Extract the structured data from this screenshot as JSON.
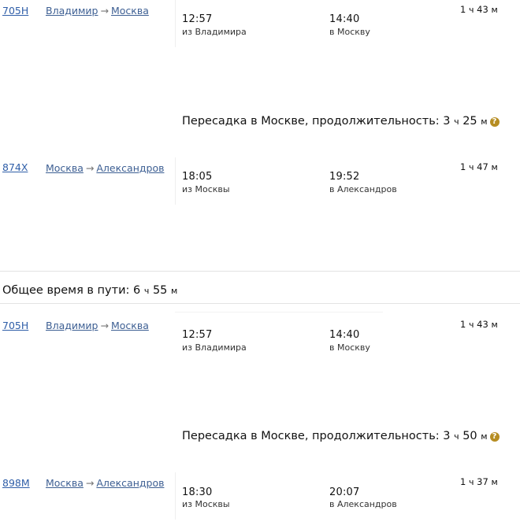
{
  "routes": [
    {
      "segments": [
        {
          "train": "705Н",
          "from_city": "Владимир",
          "to_city": "Москва",
          "dep_time": "12:57",
          "dep_label": "из Владимира",
          "arr_time": "14:40",
          "arr_label": "в Москву",
          "dur_h": "1",
          "dur_m": "43"
        },
        {
          "train": "874Х",
          "from_city": "Москва",
          "to_city": "Александров",
          "dep_time": "18:05",
          "dep_label": "из Москвы",
          "arr_time": "19:52",
          "arr_label": "в Александров",
          "dur_h": "1",
          "dur_m": "47"
        }
      ],
      "transfer": {
        "label": "Пересадка в Москве, продолжительность:",
        "h": "3",
        "m": "25"
      },
      "total": {
        "label": "Общее время в пути:",
        "h": "6",
        "m": "55"
      }
    },
    {
      "segments": [
        {
          "train": "705Н",
          "from_city": "Владимир",
          "to_city": "Москва",
          "dep_time": "12:57",
          "dep_label": "из Владимира",
          "arr_time": "14:40",
          "arr_label": "в Москву",
          "dur_h": "1",
          "dur_m": "43"
        },
        {
          "train": "898М",
          "from_city": "Москва",
          "to_city": "Александров",
          "dep_time": "18:30",
          "dep_label": "из Москвы",
          "arr_time": "20:07",
          "arr_label": "в Александров",
          "dur_h": "1",
          "dur_m": "37"
        }
      ],
      "transfer": {
        "label": "Пересадка в Москве, продолжительность:",
        "h": "3",
        "m": "50"
      }
    }
  ],
  "units": {
    "hour": "ч",
    "minute": "м",
    "arrow": "→",
    "help": "?"
  }
}
